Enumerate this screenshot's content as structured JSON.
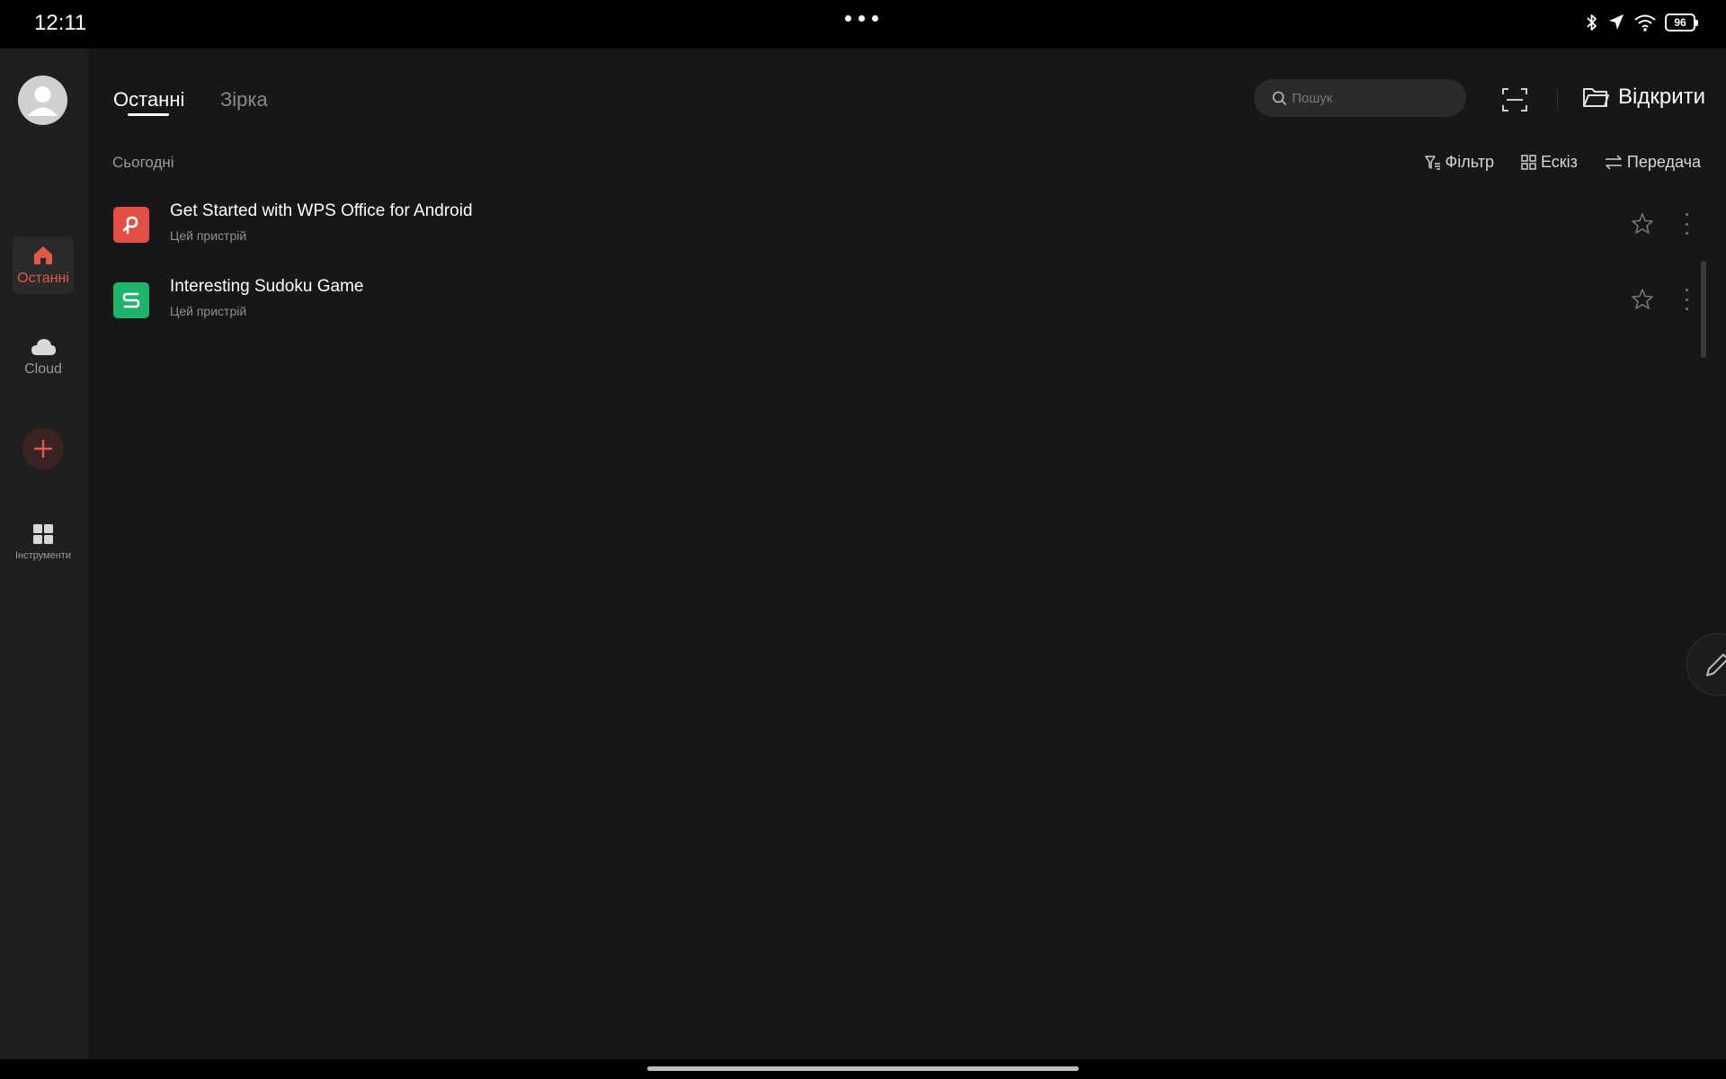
{
  "status_bar": {
    "time": "12:11",
    "battery": "96",
    "icons": [
      "bluetooth-icon",
      "location-icon",
      "wifi-icon",
      "battery-icon"
    ]
  },
  "sidebar": {
    "items": [
      {
        "label": "Останні",
        "icon": "home-icon",
        "active": true
      },
      {
        "label": "Cloud",
        "icon": "cloud-icon",
        "active": false
      },
      {
        "label": "Інструменти",
        "icon": "grid-icon",
        "active": false
      }
    ]
  },
  "tabs": {
    "recent": "Останні",
    "starred": "Зірка"
  },
  "search": {
    "placeholder": "Пошук"
  },
  "toolbar": {
    "open_label": "Відкрити"
  },
  "section": {
    "today": "Сьогодні"
  },
  "actions": {
    "filter": "Фільтр",
    "thumbnail": "Ескіз",
    "transfer": "Передача"
  },
  "files": [
    {
      "name": "Get Started with WPS Office for Android",
      "location": "Цей пристрій",
      "type": "presentation",
      "color": "#e34f47"
    },
    {
      "name": "Interesting Sudoku Game",
      "location": "Цей пристрій",
      "type": "spreadsheet",
      "color": "#1fb36b"
    }
  ],
  "colors": {
    "accent": "#e05a4b",
    "background": "#171717",
    "sidebar": "#1f1f1f"
  }
}
